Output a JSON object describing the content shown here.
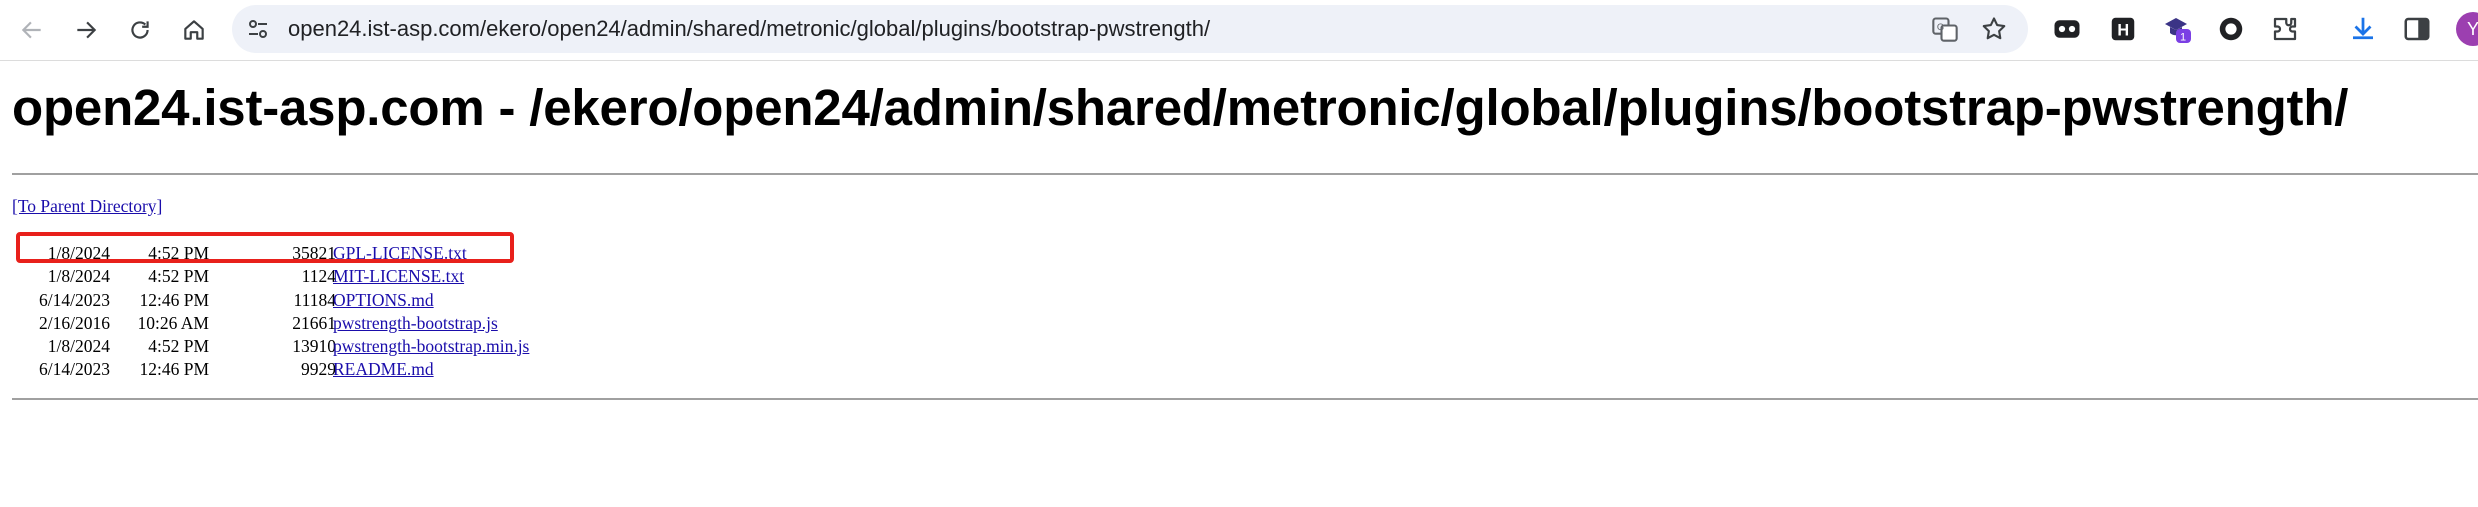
{
  "browser": {
    "url": "open24.ist-asp.com/ekero/open24/admin/shared/metronic/global/plugins/bootstrap-pwstrength/",
    "profile_initial": "Y",
    "extension_badge": "1"
  },
  "page": {
    "title": "open24.ist-asp.com - /ekero/open24/admin/shared/metronic/global/plugins/bootstrap-pwstrength/",
    "parent_link": "[To Parent Directory]",
    "files": [
      {
        "date": "1/8/2024",
        "time": "4:52 PM",
        "size": "35821",
        "name": "GPL-LICENSE.txt"
      },
      {
        "date": "1/8/2024",
        "time": "4:52 PM",
        "size": "1124",
        "name": "MIT-LICENSE.txt"
      },
      {
        "date": "6/14/2023",
        "time": "12:46 PM",
        "size": "11184",
        "name": "OPTIONS.md"
      },
      {
        "date": "2/16/2016",
        "time": "10:26 AM",
        "size": "21661",
        "name": "pwstrength-bootstrap.js"
      },
      {
        "date": "1/8/2024",
        "time": "4:52 PM",
        "size": "13910",
        "name": "pwstrength-bootstrap.min.js"
      },
      {
        "date": "6/14/2023",
        "time": "12:46 PM",
        "size": "9929",
        "name": "README.md"
      }
    ]
  },
  "icons": [
    "back-icon",
    "forward-icon",
    "reload-icon",
    "home-icon",
    "site-info-icon",
    "translate-icon",
    "bookmark-star-icon",
    "extension-icon",
    "downloads-icon",
    "side-panel-icon"
  ],
  "colors": {
    "link": "#1a0dab",
    "highlight": "#e8201b",
    "omnibox": "#eef1f8"
  }
}
